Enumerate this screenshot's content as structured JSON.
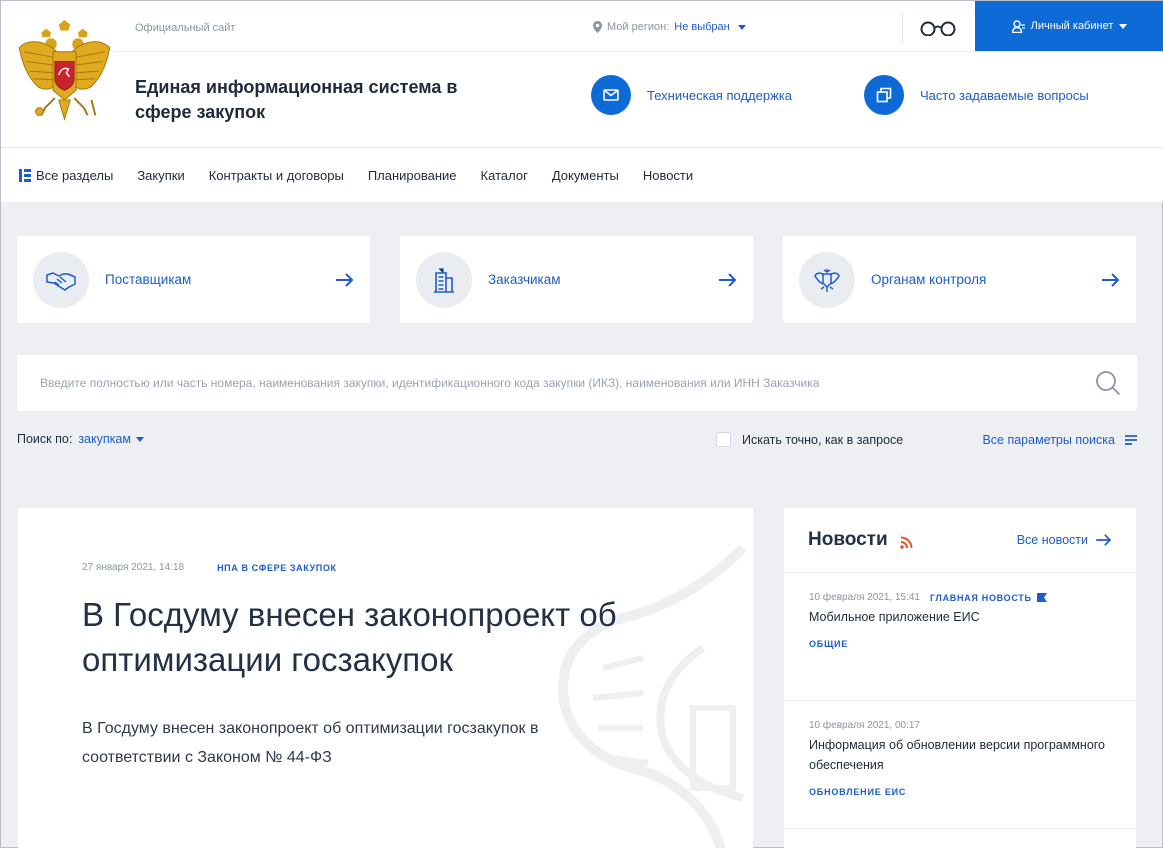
{
  "header": {
    "official_label": "Официальный сайт",
    "region_label": "Мой регион:",
    "region_value": "Не выбран",
    "cabinet_label": "Личный кабинет",
    "site_title": "Единая информационная система в сфере закупок",
    "support_label": "Техническая поддержка",
    "faq_label": "Часто задаваемые вопросы"
  },
  "nav": {
    "items": [
      "Все разделы",
      "Закупки",
      "Контракты и договоры",
      "Планирование",
      "Каталог",
      "Документы",
      "Новости"
    ]
  },
  "roles": [
    {
      "label": "Поставщикам",
      "icon": "handshake-icon"
    },
    {
      "label": "Заказчикам",
      "icon": "building-icon"
    },
    {
      "label": "Органам контроля",
      "icon": "eagle-icon"
    }
  ],
  "search": {
    "placeholder": "Введите полностью или часть номера, наименования закупки, идентификационного кода закупки (ИКЗ), наименования или ИНН Заказчика",
    "search_by_label": "Поиск по:",
    "search_by_value": "закупкам",
    "exact_label": "Искать точно, как в запросе",
    "all_params_label": "Все параметры поиска"
  },
  "main_news": {
    "date": "27 января 2021, 14:18",
    "tag": "НПА В СФЕРЕ ЗАКУПОК",
    "title": "В Госдуму внесен законопроект об оптимизации госзакупок",
    "description": "В Госдуму внесен законопроект об оптимизации госзакупок в соответствии с Законом № 44-ФЗ"
  },
  "side_news": {
    "title": "Новости",
    "all_label": "Все новости",
    "items": [
      {
        "date": "10 февраля 2021, 15:41",
        "flag": "ГЛАВНАЯ НОВОСТЬ",
        "text": "Мобильное приложение ЕИС",
        "category": "ОБЩИЕ"
      },
      {
        "date": "10 февраля 2021, 00:17",
        "flag": "",
        "text": "Информация об обновлении версии программного обеспечения",
        "category": "ОБНОВЛЕНИЕ ЕИС"
      }
    ]
  },
  "colors": {
    "accent": "#0e6ad7",
    "link": "#1e5cc6",
    "background": "#edeff3",
    "rss": "#e8532c"
  }
}
